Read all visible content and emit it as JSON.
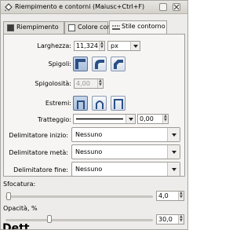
{
  "window": {
    "title": "Riempimento e contorni (Maiusc+Ctrl+F)",
    "icon": "paint-bucket-icon"
  },
  "tabs": [
    {
      "label": "Riempimento",
      "active": false
    },
    {
      "label": "Colore contorno",
      "active": false
    },
    {
      "label": "Stile contorno",
      "active": true
    }
  ],
  "stroke_style": {
    "width": {
      "label": "Larghezza:",
      "value": "11,324",
      "unit": "px"
    },
    "join": {
      "label": "Spigoli:",
      "options": [
        "miter-join",
        "round-join",
        "bevel-join"
      ],
      "selected": 0
    },
    "miter_limit": {
      "label": "Spigolosità:",
      "value": "4,00"
    },
    "cap": {
      "label": "Estremi:",
      "options": [
        "butt-cap",
        "round-cap",
        "square-cap"
      ],
      "selected": 0
    },
    "dashes": {
      "label": "Tratteggio:",
      "offset": "0,00"
    },
    "start_marker": {
      "label": "Delimitatore inizio:",
      "value": "Nessuno"
    },
    "mid_marker": {
      "label": "Delimitatore metà:",
      "value": "Nessuno"
    },
    "end_marker": {
      "label": "Delimitatore fine:",
      "value": "Nessuno"
    }
  },
  "blur": {
    "label": "Sfocatura:",
    "value": "4,0",
    "fraction": 0.02
  },
  "opacity": {
    "label": "Opacità, %",
    "value": "30,0",
    "fraction": 0.3
  },
  "footer_text": "Dett..."
}
